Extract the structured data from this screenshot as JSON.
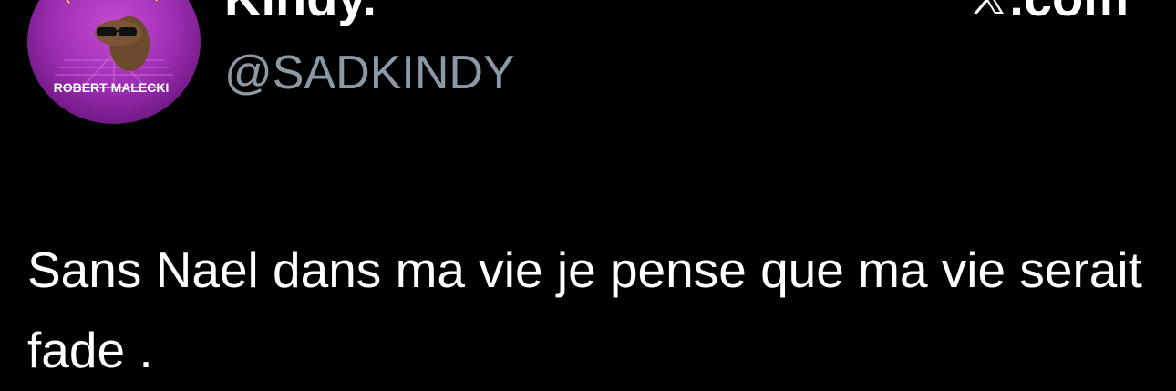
{
  "author": {
    "display_name": "Kindy.",
    "handle": "@SADKINDY",
    "avatar_text_top": "I'M IN AGONY",
    "avatar_text_bottom": "ROBERT MALECKI"
  },
  "brand": {
    "domain_text": ".com",
    "icon": "x-logo-icon"
  },
  "tweet": {
    "text": "Sans Nael dans ma vie je pense que ma vie serait fade ."
  },
  "colors": {
    "background": "#000000",
    "text_primary": "#ffffff",
    "text_secondary": "#8b98a5",
    "avatar_accent": "#a02fb6"
  }
}
